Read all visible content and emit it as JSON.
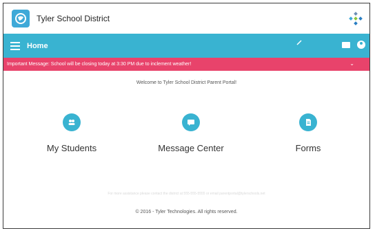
{
  "app": {
    "title": "Tyler School District"
  },
  "navbar": {
    "title": "Home"
  },
  "alert": {
    "message": "Important Message: School will be closing today at 3:30 PM due to inclement weather!"
  },
  "welcome": "Welcome to Tyler School District Parent Portal!",
  "tiles": [
    {
      "label": "My Students",
      "icon": "students-icon"
    },
    {
      "label": "Message Center",
      "icon": "message-icon"
    },
    {
      "label": "Forms",
      "icon": "forms-icon"
    }
  ],
  "contact": "For more assistance please contact the district at 555-555-5555 or email parentportal@tylerschools.net",
  "footer": "© 2016 - Tyler Technologies. All rights reserved.",
  "colors": {
    "accent": "#39b3d1",
    "alert": "#e8436b",
    "logo": "#3fa9d8"
  }
}
